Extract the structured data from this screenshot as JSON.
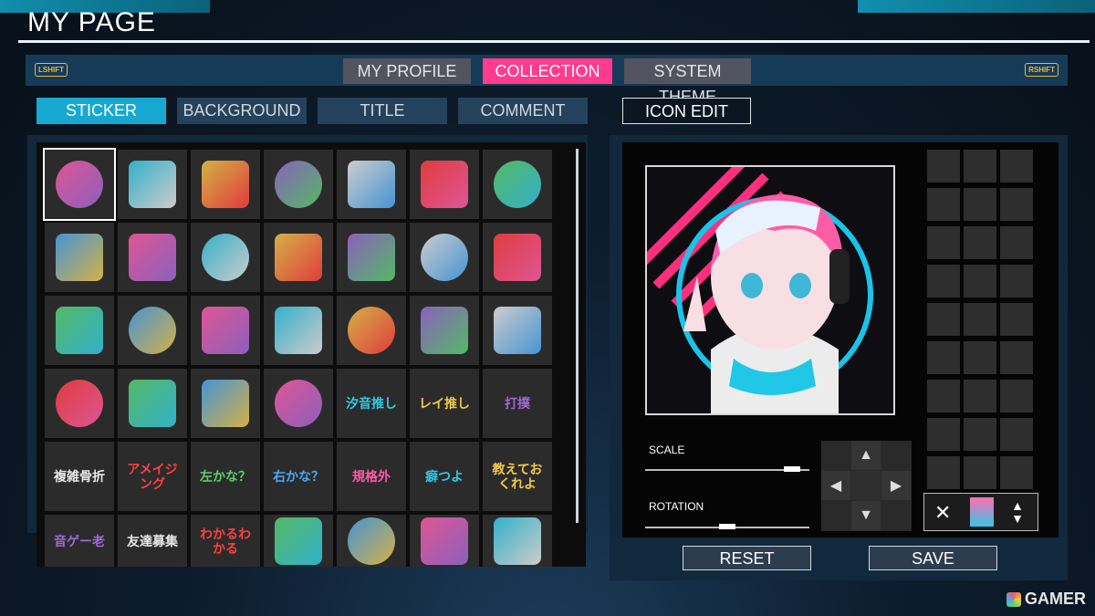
{
  "page_title": "MY PAGE",
  "top_bar": {
    "left_key": "LSHIFT",
    "right_key": "RSHIFT",
    "tabs": [
      {
        "label": "MY PROFILE",
        "active": false
      },
      {
        "label": "COLLECTION",
        "active": true
      },
      {
        "label": "SYSTEM THEME",
        "active": false
      }
    ]
  },
  "sub_tabs": [
    {
      "label": "STICKER",
      "active": true
    },
    {
      "label": "BACKGROUND",
      "active": false
    },
    {
      "label": "TITLE",
      "active": false
    },
    {
      "label": "COMMENT",
      "active": false
    }
  ],
  "icon_edit_label": "ICON EDIT",
  "stickers": [
    {
      "icon": "anime-girl-peace"
    },
    {
      "icon": "anime-girl-pose"
    },
    {
      "icon": "anime-girl-dark"
    },
    {
      "icon": "anime-girl-red"
    },
    {
      "icon": "emblem-badge"
    },
    {
      "icon": "colorful-cat"
    },
    {
      "icon": "night-scene"
    },
    {
      "icon": "bike-sign"
    },
    {
      "icon": "gold-coins"
    },
    {
      "icon": "red-silhouette"
    },
    {
      "icon": "girl-face"
    },
    {
      "icon": "girl-face-2"
    },
    {
      "icon": "santa-girl"
    },
    {
      "icon": "santa-girl-peace"
    },
    {
      "icon": "blurred-photo"
    },
    {
      "icon": "guitarist"
    },
    {
      "icon": "cat-face"
    },
    {
      "icon": "glowing-eyes"
    },
    {
      "icon": "girl-eyes"
    },
    {
      "icon": "graffiti-text"
    },
    {
      "icon": "skull"
    },
    {
      "icon": "hearts"
    },
    {
      "icon": "green-sparkle"
    },
    {
      "icon": "ring-emblem"
    },
    {
      "icon": "gold-star"
    },
    {
      "text": "汐音推し",
      "icon": "text-sticker"
    },
    {
      "text": "レイ推し",
      "icon": "text-sticker"
    },
    {
      "text": "打撲",
      "icon": "text-sticker"
    },
    {
      "text": "複雑骨折",
      "icon": "text-sticker"
    },
    {
      "text": "アメイジング",
      "icon": "text-sticker"
    },
    {
      "text": "左かな？",
      "icon": "text-sticker"
    },
    {
      "text": "右かな？",
      "icon": "text-sticker"
    },
    {
      "text": "規格外",
      "icon": "text-sticker"
    },
    {
      "text": "癖つよ",
      "icon": "text-sticker"
    },
    {
      "text": "教えておくれよ",
      "icon": "text-sticker"
    },
    {
      "text": "音ゲー老",
      "icon": "text-sticker"
    },
    {
      "text": "友達募集",
      "icon": "text-sticker"
    },
    {
      "text": "わかるわかる",
      "icon": "text-sticker"
    },
    {
      "icon": "headphones"
    },
    {
      "icon": "microphone"
    },
    {
      "icon": "electric-guitar"
    },
    {
      "icon": "bass-guitar"
    }
  ],
  "editor": {
    "scale_label": "SCALE",
    "rotation_label": "ROTATION",
    "scale_value": 0.94,
    "rotation_value": 0.5,
    "reset_label": "RESET",
    "save_label": "SAVE"
  },
  "watermark": "GAMER",
  "colors": {
    "accent_pink": "#ff3c8e",
    "accent_cyan": "#16a8d0",
    "key_yellow": "#f0b63a"
  }
}
